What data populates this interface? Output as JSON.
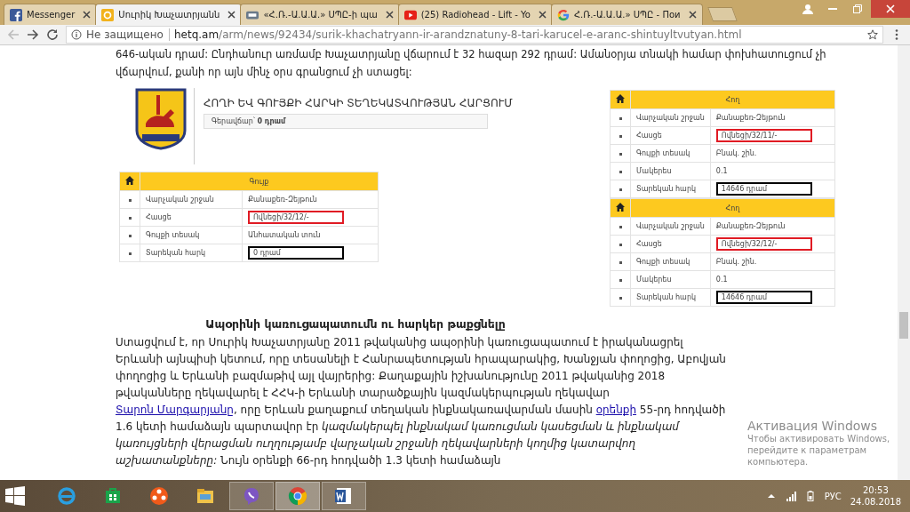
{
  "browser": {
    "tabs": [
      {
        "title": "Messenger",
        "kind": "messenger",
        "selected": false
      },
      {
        "title": "Սուրիկ Խաչատրյանն",
        "kind": "hetq",
        "selected": true
      },
      {
        "title": "«Հ.Ռ.-Ա.Ա.Ա.» ՍՊԸ-ի պա",
        "kind": "page",
        "selected": false
      },
      {
        "title": "(25) Radiohead - Lift - Yo",
        "kind": "youtube",
        "selected": false
      },
      {
        "title": "Հ.Ռ.-Ա.Ա.Ա.» ՍՊԸ - Пои",
        "kind": "google",
        "selected": false
      }
    ],
    "address": {
      "security": "Не защищено",
      "domain": "hetq.am",
      "path": "/arm/news/92434/surik-khachatryann-ir-arandznatuny-8-tari-karucel-e-aranc-shintuyltvutyan.html"
    }
  },
  "article": {
    "lead_lines": [
      "646-ական դրամ: Ընդհանուր առմամբ Խաչատրյանը վճարում է 32 հազար 292 դրամ: Ամանօրյա տնակի համար փոխհատուցում չի",
      "վճարվում, քանի որ այն մինչ օրս գրանցում չի ստացել:"
    ],
    "figure": {
      "title": "ՀՈՂԻ ԵՎ ԳՈՒՅՔԻ ՀԱՐԿԻ ՏԵՂԵԿԱՏՎՈՒԹՅԱՆ ՀԱՐՑՈՒՄ",
      "debt_label": "Գերավճար՝",
      "debt_value": "0 դրամ",
      "left_table": {
        "header": "Գույք",
        "rows": [
          {
            "label": "Վարչական շրջան",
            "value": "Քանաքեռ-Զեյթուն"
          },
          {
            "label": "Հասցե",
            "value": "Ովնեցի/32/12/-",
            "color": "#e01b24"
          },
          {
            "label": "Գույքի տեսակ",
            "value": "Անհատական տուն"
          },
          {
            "label": "Տարեկան հարկ",
            "value": "0 դրամ",
            "color": "#000000"
          }
        ]
      },
      "right_tables": [
        {
          "header": "Հող",
          "rows": [
            {
              "label": "Վարչական շրջան",
              "value": "Քանաքեռ-Զեյթուն"
            },
            {
              "label": "Հասցե",
              "value": "Ովնեցի/32/11/-",
              "color": "#e01b24"
            },
            {
              "label": "Գույքի տեսակ",
              "value": "Բնակ. շին."
            },
            {
              "label": "Մակերես",
              "value": "0.1"
            },
            {
              "label": "Տարեկան հարկ",
              "value": "14646 դրամ",
              "color": "#000000"
            }
          ]
        },
        {
          "header": "Հող",
          "rows": [
            {
              "label": "Վարչական շրջան",
              "value": "Քանաքեռ-Զեյթուն"
            },
            {
              "label": "Հասցե",
              "value": "Ովնեցի/32/12/-",
              "color": "#e01b24"
            },
            {
              "label": "Գույքի տեսակ",
              "value": "Բնակ. շին."
            },
            {
              "label": "Մակերես",
              "value": "0.1"
            },
            {
              "label": "Տարեկան հարկ",
              "value": "14646 դրամ",
              "color": "#000000"
            }
          ]
        }
      ]
    },
    "heading": "Ապօրինի կառուցապատումն ու հարկեր թաքցնելը",
    "paragraph": [
      {
        "kind": "plain",
        "text": "Ստացվում է, որ Սուրիկ Խաչատրյանը 2011 թվականից ապօրինի կառուցապատում է իրականացրել Երևանի այնպիսի կետում, որը տեսանելի է Հանրապետության հրապարակից, Խանջյան փողոցից, Աբովյան փողոցից և Երևանի բազմաթիվ այլ վայրերից: Քաղաքային իշխանությունը 2011 թվականից 2018 թվականները ղեկավարել է ՀՀԿ-ի Երևանի տարածքային կազմակերպության ղեկավար "
      },
      {
        "kind": "link",
        "text": "Տարոն Մարգարյանը"
      },
      {
        "kind": "plain",
        "text": ", որը Երևան քաղաքում տեղական ինքնակառավարման մասին "
      },
      {
        "kind": "link",
        "text": "օրենքի"
      },
      {
        "kind": "plain",
        "text": " 55-րդ հոդվածի 1.6 կետի համաձայն պարտավոր էր "
      },
      {
        "kind": "italic",
        "text": "կազմակերպել ինքնակամ կառուցման կասեցման և ինքնակամ կառույցների վերացման ուղղությամբ վարչական շրջանի ղեկավարների կողմից կատարվող աշխատանքները:"
      },
      {
        "kind": "plain",
        "text": " Նույն օրենքի 66-րդ հոդվածի 1.3 կետի համաձայն"
      }
    ]
  },
  "activation": {
    "title": "Активация Windows",
    "text": "Чтобы активировать Windows, перейдите к параметрам компьютера."
  },
  "taskbar": {
    "apps": [
      {
        "kind": "ie",
        "running": false,
        "selected": false
      },
      {
        "kind": "store",
        "running": false,
        "selected": false
      },
      {
        "kind": "media",
        "running": false,
        "selected": false
      },
      {
        "kind": "explorer",
        "running": false,
        "selected": false
      },
      {
        "kind": "viber",
        "running": true,
        "selected": false
      },
      {
        "kind": "chrome",
        "running": true,
        "selected": true
      },
      {
        "kind": "word",
        "running": true,
        "selected": false
      }
    ],
    "language": "РУС",
    "time": "20:53",
    "date": "24.08.2018"
  }
}
